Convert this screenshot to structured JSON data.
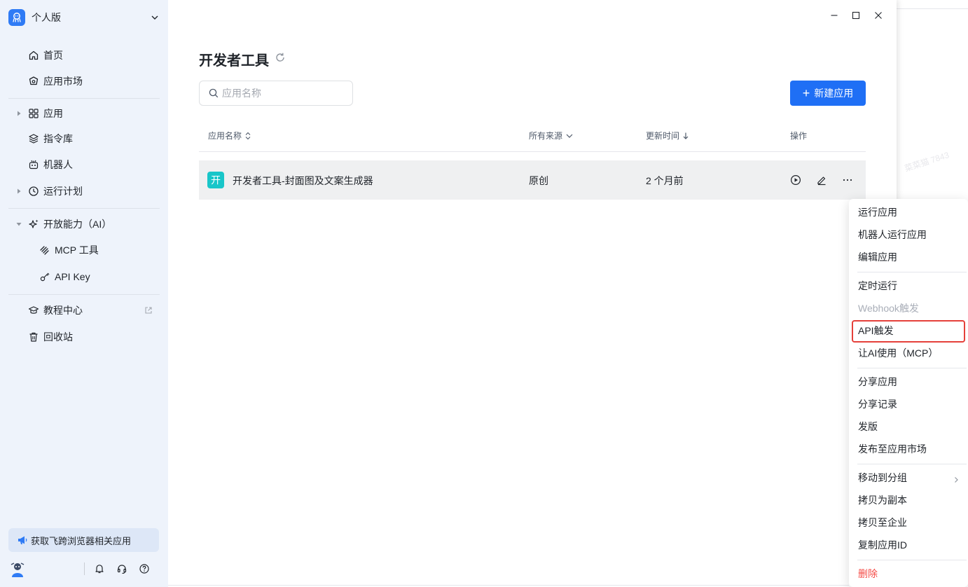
{
  "workspace": {
    "name": "个人版"
  },
  "sidebar": {
    "items": [
      {
        "label": "首页",
        "icon": "home-icon"
      },
      {
        "label": "应用市场",
        "icon": "market-icon"
      },
      {
        "label": "应用",
        "icon": "grid-icon"
      },
      {
        "label": "指令库",
        "icon": "layers-icon"
      },
      {
        "label": "机器人",
        "icon": "robot-icon"
      },
      {
        "label": "运行计划",
        "icon": "clock-icon"
      },
      {
        "label": "开放能力（AI）",
        "icon": "sparkle-icon"
      },
      {
        "label": "MCP 工具",
        "icon": "mcp-icon"
      },
      {
        "label": "API Key",
        "icon": "key-icon"
      },
      {
        "label": "教程中心",
        "icon": "graduation-cap-icon"
      },
      {
        "label": "回收站",
        "icon": "trash-icon"
      }
    ],
    "promo": "获取飞跨浏览器相关应用"
  },
  "main": {
    "title": "开发者工具",
    "search_placeholder": "应用名称",
    "new_button": "新建应用",
    "columns": {
      "name": "应用名称",
      "source": "所有来源",
      "updated": "更新时间",
      "actions": "操作"
    },
    "rows": [
      {
        "badge": "开",
        "name": "开发者工具-封面图及文案生成器",
        "source": "原创",
        "updated": "2 个月前"
      }
    ]
  },
  "context_menu": {
    "items": [
      "运行应用",
      "机器人运行应用",
      "编辑应用",
      "定时运行",
      "Webhook触发",
      "API触发",
      "让AI使用（MCP）",
      "分享应用",
      "分享记录",
      "发版",
      "发布至应用市场",
      "移动到分组",
      "拷贝为副本",
      "拷贝至企业",
      "复制应用ID",
      "删除"
    ],
    "highlighted": "API触发"
  },
  "colors": {
    "accent": "#1f6ff5",
    "badge": "#19c6c9",
    "danger": "#f54a45",
    "highlight": "#e5403a"
  },
  "background_watermark": "菜菜猫 7843"
}
